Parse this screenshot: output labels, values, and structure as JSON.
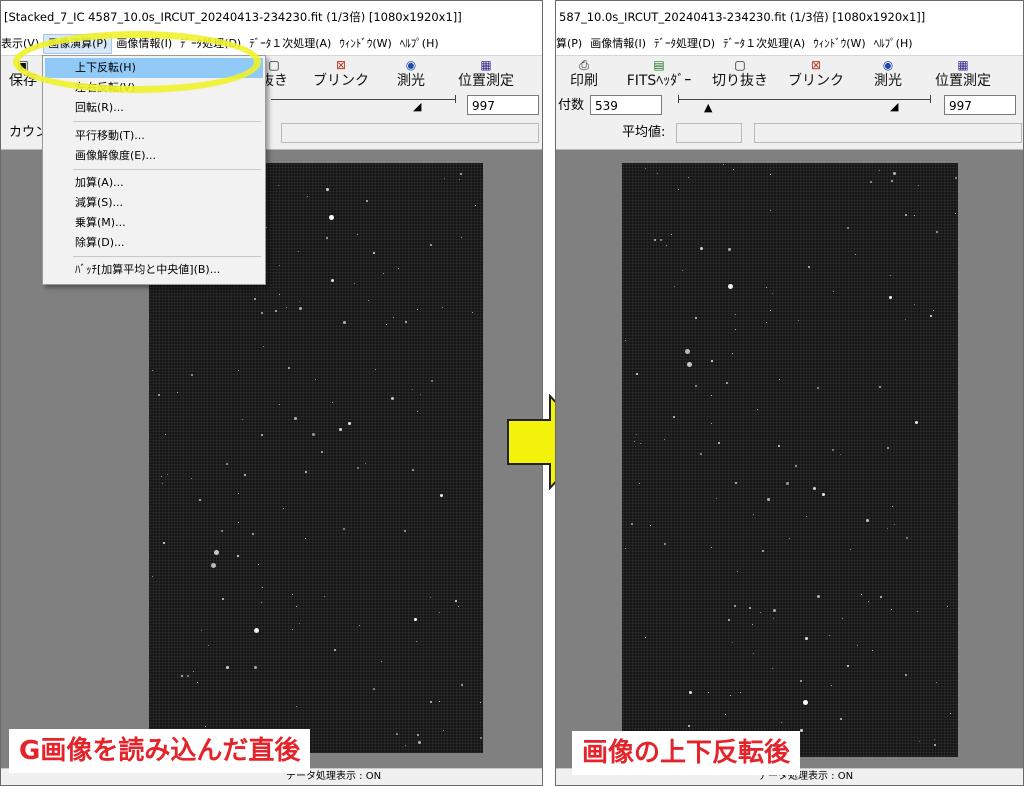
{
  "left": {
    "title": "[Stacked_7_IC 4587_10.0s_IRCUT_20240413-234230.fit (1/3倍) [1080x1920x1]]",
    "menu": [
      "表示(V)",
      "画像演算(P)",
      "画像情報(I)",
      "ﾃﾞｰﾀ処理(D)",
      "ﾃﾞｰﾀ１次処理(A)",
      "ｳｨﾝﾄﾞｳ(W)",
      "ﾍﾙﾌﾟ(H)"
    ],
    "toolbar": {
      "save": "保存",
      "crop_suffix": "抜き",
      "blink": "ブリンク",
      "photometry": "測光",
      "astrometry": "位置測定"
    },
    "slider_max": "997",
    "count_label": "カウント",
    "dropdown": {
      "flip_vertical": "上下反転(H)",
      "flip_horizontal": "左右反転(V)",
      "rotate": "回転(R)...",
      "translate": "平行移動(T)...",
      "resolution": "画像解像度(E)...",
      "add": "加算(A)...",
      "subtract": "減算(S)...",
      "multiply": "乗算(M)...",
      "divide": "除算(D)...",
      "batch": "ﾊﾞｯﾁ[加算平均と中央値](B)..."
    },
    "status": "データ処理表示 : ON",
    "caption": "G画像を読み込んだ直後"
  },
  "right": {
    "title": "587_10.0s_IRCUT_20240413-234230.fit (1/3倍) [1080x1920x1]]",
    "menu": [
      "算(P)",
      "画像情報(I)",
      "ﾃﾞｰﾀ処理(D)",
      "ﾃﾞｰﾀ１次処理(A)",
      "ｳｨﾝﾄﾞｳ(W)",
      "ﾍﾙﾌﾟ(H)"
    ],
    "toolbar": {
      "print": "印刷",
      "fits_header": "FITSﾍｯﾀﾞｰ",
      "crop": "切り抜き",
      "blink": "ブリンク",
      "photometry": "測光",
      "astrometry": "位置測定"
    },
    "count_label": "付数",
    "slider_min": "539",
    "slider_max": "997",
    "mean_label": "平均値:",
    "status": "データ処理表示 : ON",
    "caption": "画像の上下反転後"
  },
  "colors": {
    "highlight": "#eef22a",
    "caption_text": "#e4232a",
    "arrow_fill": "#f2f20a",
    "selected_menu": "#91c9f7"
  }
}
